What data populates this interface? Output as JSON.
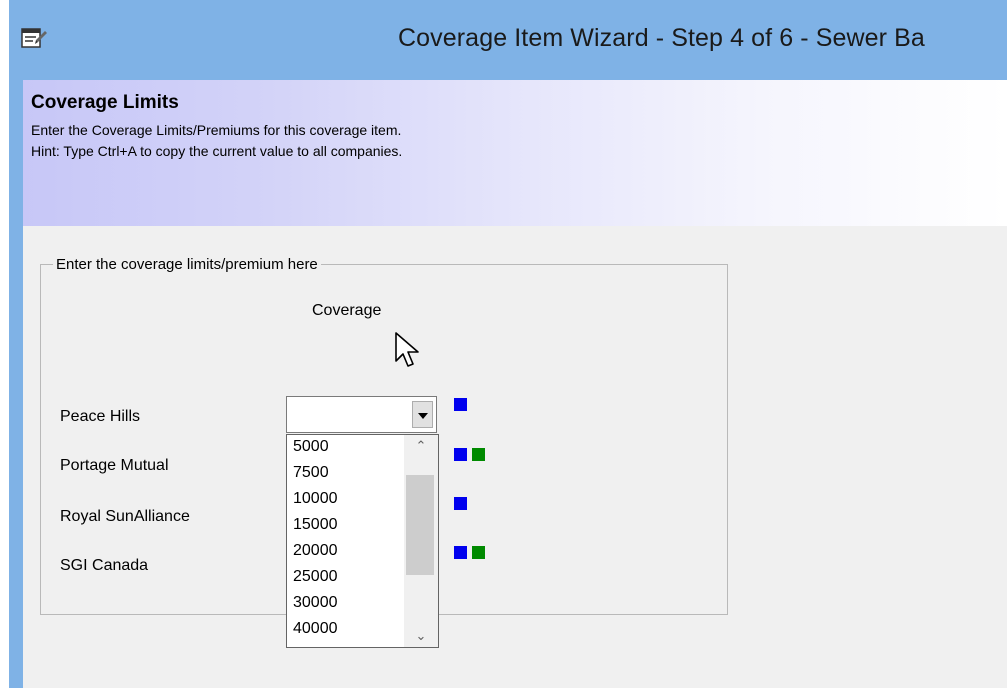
{
  "window": {
    "title": "Coverage Item Wizard - Step 4 of 6 - Sewer Ba",
    "icon": "properties-icon",
    "accent_color": "#7fb2e6"
  },
  "header": {
    "title": "Coverage Limits",
    "line1": "Enter the Coverage Limits/Premiums for this coverage item.",
    "line2": "Hint: Type Ctrl+A to copy the current value to all companies."
  },
  "group": {
    "legend": "Enter the coverage limits/premium here",
    "column_header": "Coverage"
  },
  "companies": [
    {
      "label": "Peace Hills",
      "indicators": [
        "blue"
      ]
    },
    {
      "label": "Portage Mutual",
      "indicators": [
        "blue",
        "green"
      ]
    },
    {
      "label": "Royal SunAlliance",
      "indicators": [
        "blue"
      ]
    },
    {
      "label": "SGI Canada",
      "indicators": [
        "blue",
        "green"
      ]
    }
  ],
  "combo": {
    "value": "",
    "options": [
      "5000",
      "7500",
      "10000",
      "15000",
      "20000",
      "25000",
      "30000",
      "40000"
    ]
  },
  "colors": {
    "indicator_blue": "#0000ee",
    "indicator_green": "#008a00"
  }
}
